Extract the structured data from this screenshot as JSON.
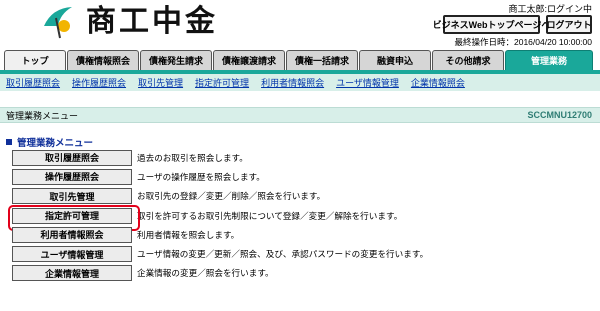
{
  "header": {
    "logo_text": "商工中金",
    "user_status": "商工太郎:ログイン中",
    "biz_top_label": "ビジネスWebトップページへ",
    "logout_label": "ログアウト",
    "last_operation": "最終操作日時：2016/04/20 10:00:00"
  },
  "tabs": [
    {
      "label": "トップ",
      "state": "normal"
    },
    {
      "label": "債権情報照会",
      "state": "normal"
    },
    {
      "label": "債権発生請求",
      "state": "normal"
    },
    {
      "label": "債権譲渡請求",
      "state": "normal"
    },
    {
      "label": "債権一括請求",
      "state": "normal"
    },
    {
      "label": "融資申込",
      "state": "normal"
    },
    {
      "label": "その他請求",
      "state": "normal"
    },
    {
      "label": "管理業務",
      "state": "active"
    }
  ],
  "subnav": [
    {
      "label": "取引履歴照会"
    },
    {
      "label": "操作履歴照会"
    },
    {
      "label": "取引先管理"
    },
    {
      "label": "指定許可管理"
    },
    {
      "label": "利用者情報照会"
    },
    {
      "label": "ユーザ情報管理"
    },
    {
      "label": "企業情報照会"
    }
  ],
  "title_bar": {
    "title": "管理業務メニュー",
    "screen_id": "SCCMNU12700"
  },
  "section_heading": "管理業務メニュー",
  "menu": [
    {
      "button": "取引履歴照会",
      "description": "過去のお取引を照会します。",
      "highlighted": false
    },
    {
      "button": "操作履歴照会",
      "description": "ユーザの操作履歴を照会します。",
      "highlighted": false
    },
    {
      "button": "取引先管理",
      "description": "お取引先の登録／変更／削除／照会を行います。",
      "highlighted": false
    },
    {
      "button": "指定許可管理",
      "description": "取引を許可するお取引先制限について登録／変更／解除を行います。",
      "highlighted": true
    },
    {
      "button": "利用者情報照会",
      "description": "利用者情報を照会します。",
      "highlighted": false
    },
    {
      "button": "ユーザ情報管理",
      "description": "ユーザ情報の変更／更新／照会、及び、承認パスワードの変更を行います。",
      "highlighted": false
    },
    {
      "button": "企業情報管理",
      "description": "企業情報の変更／照会を行います。",
      "highlighted": false
    }
  ],
  "colors": {
    "accent": "#1aa89a",
    "subnav_bg": "#d8efe9",
    "heading": "#10309a",
    "highlight": "#e2001a"
  }
}
